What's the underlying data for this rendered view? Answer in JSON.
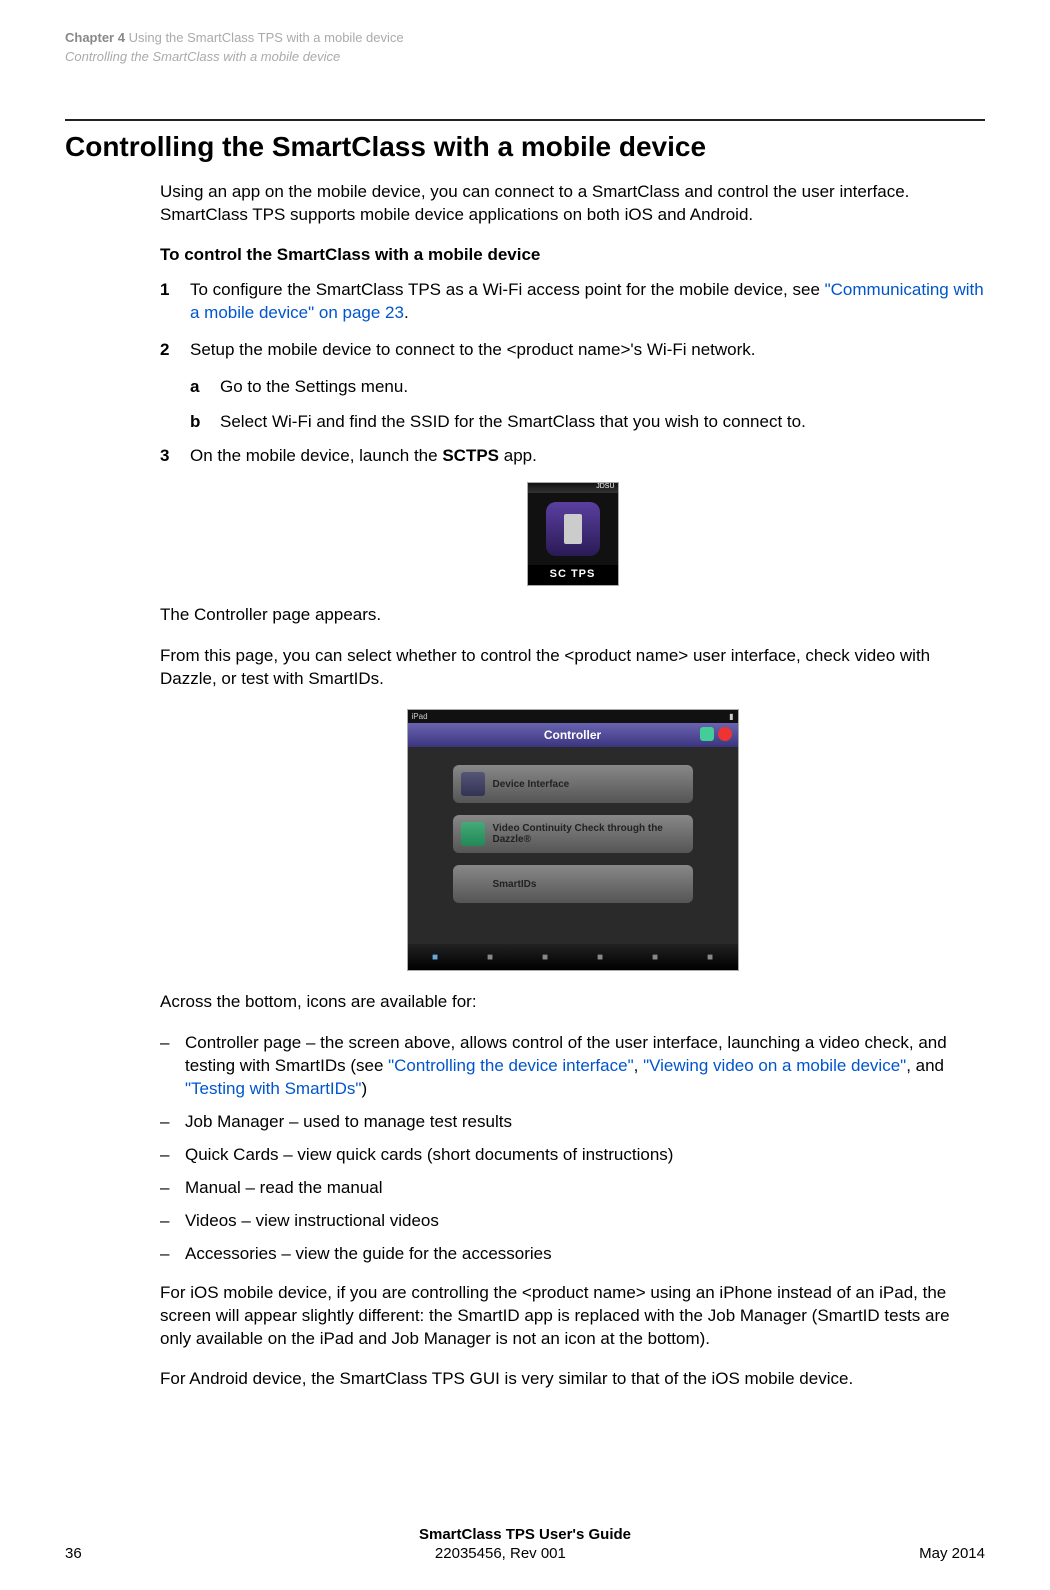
{
  "header": {
    "chapter_prefix": "Chapter 4",
    "chapter_title": "Using the SmartClass TPS  with a mobile device",
    "section_title": "Controlling the SmartClass with a mobile device"
  },
  "main": {
    "h1": "Controlling the SmartClass with a mobile device",
    "intro": "Using an app on the mobile device, you can connect to a SmartClass and control the user interface. SmartClass TPS supports mobile device applications on both iOS and Android.",
    "sub_heading": "To control the SmartClass with a mobile device",
    "step1_num": "1",
    "step1_text_a": "To configure the SmartClass TPS as a Wi-Fi access point for the mobile device, see ",
    "step1_link": "\"Communicating with a mobile device\" on page 23",
    "step1_text_b": ".",
    "step2_num": "2",
    "step2_text": "Setup the mobile device to connect to the <product name>'s Wi-Fi network.",
    "step2a_num": "a",
    "step2a_text": "Go to the Settings menu.",
    "step2b_num": "b",
    "step2b_text": "Select Wi-Fi and find the SSID for the SmartClass that you wish to connect to.",
    "step3_num": "3",
    "step3_text_a": "On the mobile device, launch the ",
    "step3_bold": "SCTPS",
    "step3_text_b": " app.",
    "app_icon": {
      "brand": "JDSU",
      "label": "SC TPS"
    },
    "after_icon_1": "The Controller page appears.",
    "after_icon_2": "From this page, you can select whether to control the <product name> user interface, check video with Dazzle, or test with SmartIDs.",
    "controller_ui": {
      "status_left": "iPad",
      "title": "Controller",
      "btn1": "Device Interface",
      "btn2": "Video Continuity Check through the Dazzle®",
      "btn3": "SmartIDs"
    },
    "after_fig": "Across the bottom, icons are available for:",
    "bullets": {
      "b1_a": "Controller page – the screen above, allows control of the user interface, launching a video check, and testing with SmartIDs (see ",
      "b1_link1": "\"Controlling the device interface\"",
      "b1_sep1": ", ",
      "b1_link2": "\"Viewing video on a mobile device\"",
      "b1_sep2": ", and ",
      "b1_link3": "\"Testing with SmartIDs\"",
      "b1_end": ")",
      "b2": "Job Manager – used to manage test results",
      "b3": "Quick Cards – view quick cards (short documents of instructions)",
      "b4": "Manual – read the manual",
      "b5": "Videos – view instructional videos",
      "b6": "Accessories – view the guide for the accessories"
    },
    "closing1": "For iOS mobile device, if you are controlling the <product name> using an iPhone instead of an iPad, the screen will appear slightly different: the SmartID app is replaced with the Job Manager (SmartID tests are only available on the iPad and Job Manager is not an icon at the bottom).",
    "closing2": "For Android device, the SmartClass TPS GUI is very similar to that of the iOS mobile device."
  },
  "footer": {
    "title": "SmartClass TPS User's Guide",
    "page_num": "36",
    "doc_id": "22035456, Rev 001",
    "date": "May 2014"
  }
}
